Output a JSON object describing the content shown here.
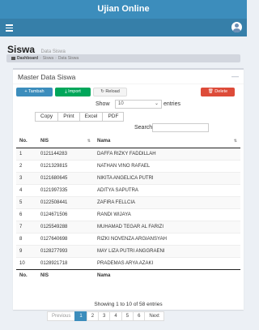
{
  "app": {
    "title": "Ujian Online"
  },
  "header": {
    "title": "Siswa",
    "subtitle": "Data Siswa"
  },
  "breadcrumb": {
    "home": "Dashboard",
    "items": [
      "Siswa",
      "Data Siswa"
    ]
  },
  "box": {
    "title": "Master Data Siswa",
    "minimize": "—",
    "buttons": {
      "tambah": "+ Tambah",
      "import": "⤓ Import",
      "reload": "↻ Reload",
      "delete": "🗑 Delete"
    }
  },
  "length_menu": {
    "show_label": "Show",
    "selected": "10",
    "suffix": "entries"
  },
  "export_buttons": [
    "Copy",
    "Print",
    "Excel",
    "PDF"
  ],
  "search": {
    "label": "Search:",
    "value": ""
  },
  "table": {
    "columns": [
      "No.",
      "NIS",
      "Nama"
    ],
    "rows": [
      [
        "1",
        "0121144283",
        "DAFFA RIZKY FADDILLAH"
      ],
      [
        "2",
        "0121329815",
        "NATHAN VINO RAFAEL"
      ],
      [
        "3",
        "0121680645",
        "NIKITA ANGELICA PUTRI"
      ],
      [
        "4",
        "0121997335",
        "ADITYA SAPUTRA"
      ],
      [
        "5",
        "0122508441",
        "ZAFIRA FELLCIA"
      ],
      [
        "6",
        "0124671506",
        "RANDI WIJAYA"
      ],
      [
        "7",
        "0125549288",
        "MUHAMAD TEGAR AL FARIZI"
      ],
      [
        "8",
        "0127640698",
        "RIZKI NOVENZA ARGIANSYAH"
      ],
      [
        "9",
        "0128277993",
        "MAY LIZA PUTRI ANGGRAENI"
      ],
      [
        "10",
        "0128921718",
        "PRADEMAS ARYA AZAKI"
      ]
    ]
  },
  "info": "Showing 1 to 10 of 58 entries",
  "pagination": {
    "previous": "Previous",
    "pages": [
      "1",
      "2",
      "3",
      "4",
      "5",
      "6"
    ],
    "next": "Next",
    "current": "1"
  },
  "colors": {
    "primary": "#3c8dbc",
    "navbar": "#367fa9",
    "success": "#00a65a",
    "danger": "#dd4b39"
  }
}
